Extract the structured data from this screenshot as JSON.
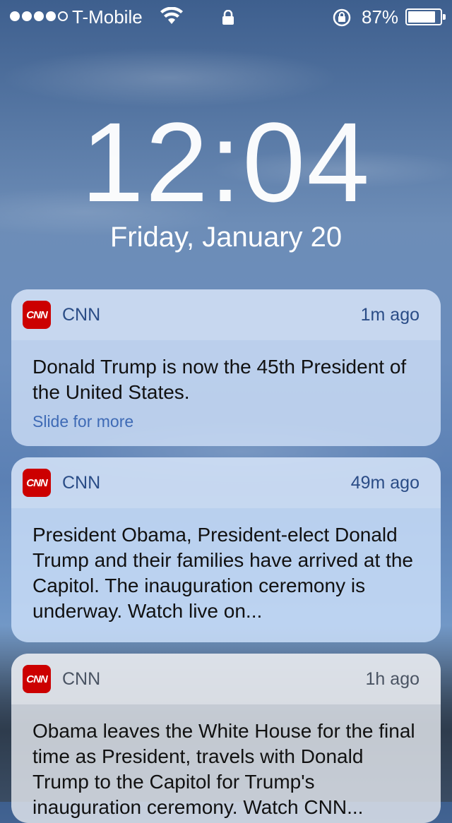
{
  "status_bar": {
    "signal_bars": 4,
    "signal_max": 5,
    "carrier": "T-Mobile",
    "battery_percent": "87%",
    "battery_level": 0.87
  },
  "lock_screen": {
    "time": "12:04",
    "date": "Friday, January 20"
  },
  "notifications": [
    {
      "app": "CNN",
      "icon": "cnn-logo",
      "time": "1m ago",
      "body": "Donald Trump is now the 45th President of the United States.",
      "action": "Slide for more"
    },
    {
      "app": "CNN",
      "icon": "cnn-logo",
      "time": "49m ago",
      "body": "President Obama, President-elect Donald Trump and their families have arrived at the Capitol. The inauguration ceremony is underway. Watch live on..."
    },
    {
      "app": "CNN",
      "icon": "cnn-logo",
      "time": "1h ago",
      "body": "Obama leaves the White House for the final time as President, travels with Donald Trump to the Capitol for Trump's inauguration ceremony. Watch CNN..."
    }
  ],
  "colors": {
    "app_icon_red": "#cc0000",
    "link_blue": "#3e6ab5"
  }
}
